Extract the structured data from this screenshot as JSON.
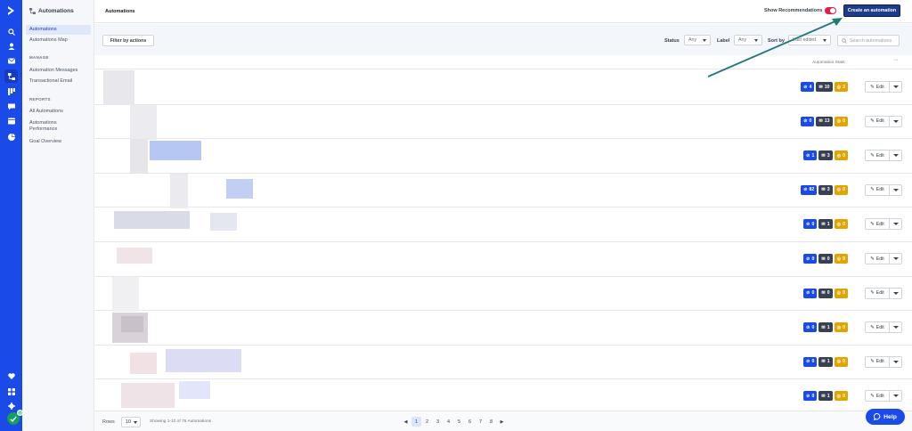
{
  "nav_rail": {
    "icons": [
      "logo-chevron-icon",
      "search-icon",
      "contacts-icon",
      "campaigns-icon",
      "automations-icon",
      "pipelines-icon",
      "conversations-icon",
      "site-icon",
      "reports-icon",
      "favorites-icon",
      "apps-icon",
      "settings-icon"
    ],
    "accent": "#1a4ae8"
  },
  "subnav": {
    "header": "Automations",
    "items_top": [
      "Automations",
      "Automations Map"
    ],
    "section_manage": "MANAGE",
    "items_manage": [
      "Automation Messages",
      "Transactional Email"
    ],
    "section_reports": "REPORTS",
    "items_reports": [
      "All Automations",
      "Automations Performance",
      "Goal Overview"
    ]
  },
  "topbar": {
    "title": "Automations",
    "recommendations_label": "Show Recommendations",
    "create_label": "Create an automation"
  },
  "filters": {
    "filter_button": "Filter by actions",
    "status_label": "Status",
    "status_value": "Any",
    "label_label": "Label",
    "label_value": "Any",
    "sort_label": "Sort by",
    "sort_value": "Last edited",
    "search_placeholder": "Search automations"
  },
  "list": {
    "stats_header": "Automation Stats",
    "more": "···",
    "edit_label": "Edit",
    "rows": [
      {
        "contacts": "4",
        "emails": "10",
        "goals": "3"
      },
      {
        "contacts": "0",
        "emails": "13",
        "goals": "0"
      },
      {
        "contacts": "1",
        "emails": "3",
        "goals": "0"
      },
      {
        "contacts": "82",
        "emails": "3",
        "goals": "0"
      },
      {
        "contacts": "0",
        "emails": "1",
        "goals": "0"
      },
      {
        "contacts": "0",
        "emails": "0",
        "goals": "9"
      },
      {
        "contacts": "0",
        "emails": "0",
        "goals": "0"
      },
      {
        "contacts": "0",
        "emails": "1",
        "goals": "0"
      },
      {
        "contacts": "0",
        "emails": "1",
        "goals": "0"
      },
      {
        "contacts": "0",
        "emails": "1",
        "goals": "0"
      }
    ]
  },
  "pager": {
    "rows_label": "Rows",
    "rows_value": "10",
    "showing": "Showing 1-10 of 76 Automations",
    "prev": "◀",
    "next": "▶",
    "pages": [
      "1",
      "2",
      "3",
      "4",
      "5",
      "6",
      "7",
      "8"
    ],
    "current": "1"
  },
  "help": {
    "label": "Help"
  },
  "colors": {
    "blue": "#1a4ae8",
    "dark": "#374151",
    "gold": "#e0a500",
    "annotation": "#1f7a7a"
  }
}
